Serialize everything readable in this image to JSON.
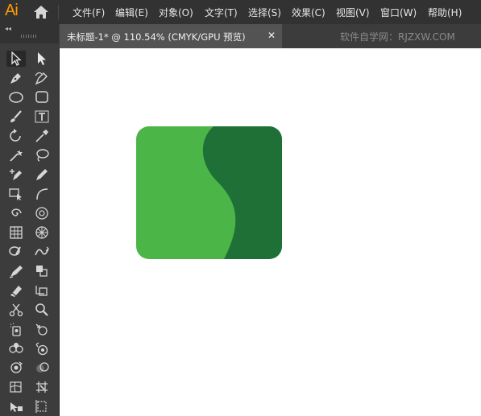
{
  "app": {
    "logo": "Ai",
    "home_icon": "home-icon"
  },
  "menu": [
    "文件(F)",
    "编辑(E)",
    "对象(O)",
    "文字(T)",
    "选择(S)",
    "效果(C)",
    "视图(V)",
    "窗口(W)",
    "帮助(H)"
  ],
  "panel": {
    "collapse": "◂◂"
  },
  "document": {
    "tab_title": "未标题-1* @ 110.54% (CMYK/GPU 预览)",
    "close": "✕"
  },
  "watermark": "软件自学网：RJZXW.COM",
  "toolbar": {
    "tools": [
      {
        "name": "selection-tool-icon"
      },
      {
        "name": "direct-selection-tool-icon"
      },
      {
        "name": "pen-tool-icon"
      },
      {
        "name": "curvature-tool-icon"
      },
      {
        "name": "ellipse-tool-icon"
      },
      {
        "name": "rectangle-tool-icon"
      },
      {
        "name": "paintbrush-tool-icon"
      },
      {
        "name": "type-tool-icon"
      },
      {
        "name": "rotate-tool-icon"
      },
      {
        "name": "eyedropper-tool-icon"
      },
      {
        "name": "magic-wand-tool-icon"
      },
      {
        "name": "lasso-tool-icon"
      },
      {
        "name": "add-anchor-tool-icon"
      },
      {
        "name": "pencil-tool-icon"
      },
      {
        "name": "free-transform-tool-icon"
      },
      {
        "name": "arc-tool-icon"
      },
      {
        "name": "spiral-tool-icon"
      },
      {
        "name": "polar-grid-tool-icon"
      },
      {
        "name": "rectangular-grid-tool-icon"
      },
      {
        "name": "perspective-grid-tool-icon"
      },
      {
        "name": "blob-brush-tool-icon"
      },
      {
        "name": "width-tool-icon"
      },
      {
        "name": "shaper-tool-icon"
      },
      {
        "name": "shape-builder-tool-icon"
      },
      {
        "name": "eraser-tool-icon"
      },
      {
        "name": "artboard-tool-icon"
      },
      {
        "name": "scissors-tool-icon"
      },
      {
        "name": "zoom-tool-icon"
      },
      {
        "name": "symbol-sprayer-tool-icon"
      },
      {
        "name": "symbol-shifter-tool-icon"
      },
      {
        "name": "symbol-scruncher-tool-icon"
      },
      {
        "name": "symbol-sizer-tool-icon"
      },
      {
        "name": "symbol-spinner-tool-icon"
      },
      {
        "name": "symbol-stainer-tool-icon"
      },
      {
        "name": "mesh-tool-icon"
      },
      {
        "name": "slice-tool-icon"
      },
      {
        "name": "puppet-warp-tool-icon"
      },
      {
        "name": "slice-select-tool-icon"
      }
    ]
  },
  "artwork": {
    "light_green": "#4bb548",
    "dark_green": "#1f7037"
  }
}
